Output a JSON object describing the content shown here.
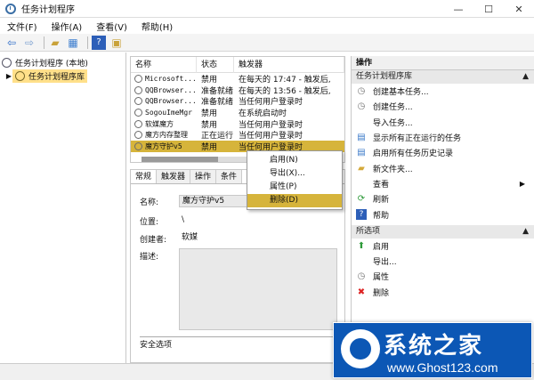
{
  "window": {
    "title": "任务计划程序"
  },
  "menubar": [
    "文件(F)",
    "操作(A)",
    "查看(V)",
    "帮助(H)"
  ],
  "tree": {
    "root": "任务计划程序 (本地)",
    "library": "任务计划程序库"
  },
  "list": {
    "headers": [
      "名称",
      "状态",
      "触发器"
    ],
    "rows": [
      [
        "Microsoft...",
        "禁用",
        "在每天的 17:47 - 触发后,"
      ],
      [
        "QQBrowser...",
        "准备就绪",
        "在每天的 13:56 - 触发后,"
      ],
      [
        "QQBrowser...",
        "准备就绪",
        "当任何用户登录时"
      ],
      [
        "SogouImeMgr",
        "禁用",
        "在系统启动时"
      ],
      [
        "软媒魔方",
        "禁用",
        "当任何用户登录时"
      ],
      [
        "魔方内存整理",
        "正在运行",
        "当任何用户登录时"
      ],
      [
        "魔方守护v5",
        "禁用",
        "当任何用户登录时"
      ]
    ]
  },
  "detail": {
    "tabs": [
      "常规",
      "触发器",
      "操作",
      "条件"
    ],
    "name_label": "名称:",
    "name_value": "魔方守护v5",
    "location_label": "位置:",
    "location_value": "\\",
    "author_label": "创建者:",
    "author_value": "软媒",
    "description_label": "描述:",
    "security_label": "安全选项"
  },
  "context_menu": [
    "启用(N)",
    "导出(X)...",
    "属性(P)",
    "删除(D)"
  ],
  "actions": {
    "title": "操作",
    "group1": "任务计划程序库",
    "items1": [
      "创建基本任务...",
      "创建任务...",
      "导入任务...",
      "显示所有正在运行的任务",
      "启用所有任务历史记录",
      "新文件夹...",
      "查看",
      "刷新",
      "帮助"
    ],
    "group2": "所选项",
    "items2": [
      "启用",
      "导出...",
      "属性",
      "删除"
    ]
  },
  "watermark": {
    "title": "系统之家",
    "url": "www.Ghost123.com"
  }
}
